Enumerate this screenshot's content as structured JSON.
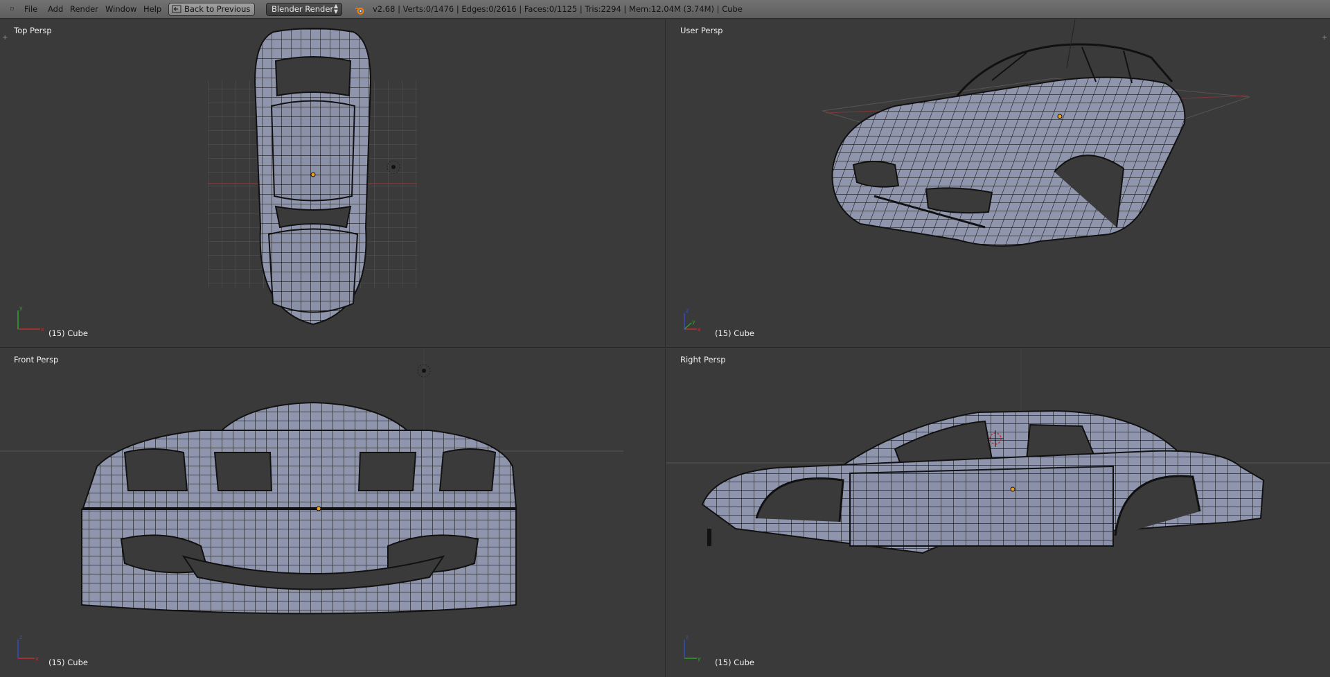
{
  "menu": {
    "editor_icon": "▫",
    "items": [
      "File",
      "Add",
      "Render",
      "Window",
      "Help"
    ],
    "back_button": "Back to Previous",
    "render_engine": "Blender Render",
    "blender_logo_icon": "blender-logo-icon",
    "stats": "v2.68 | Verts:0/1476 | Edges:0/2616 | Faces:0/1125 | Tris:2294 | Mem:12.04M (3.74M) | Cube"
  },
  "viewports": {
    "top_left": {
      "label": "Top Persp",
      "object": "(15) Cube",
      "axes": [
        "x",
        "y"
      ]
    },
    "top_right": {
      "label": "User Persp",
      "object": "(15) Cube",
      "axes": [
        "x",
        "y",
        "z"
      ]
    },
    "bottom_left": {
      "label": "Front Persp",
      "object": "(15) Cube",
      "axes": [
        "x",
        "z"
      ]
    },
    "bottom_right": {
      "label": "Right Persp",
      "object": "(15) Cube",
      "axes": [
        "y",
        "z"
      ]
    }
  },
  "colors": {
    "mesh_fill": "#8f95ad",
    "wire": "#111111",
    "grid": "#555555",
    "axis_x": "#c03030",
    "axis_y": "#30a030",
    "axis_z": "#3050c0",
    "origin": "#f0a020"
  }
}
